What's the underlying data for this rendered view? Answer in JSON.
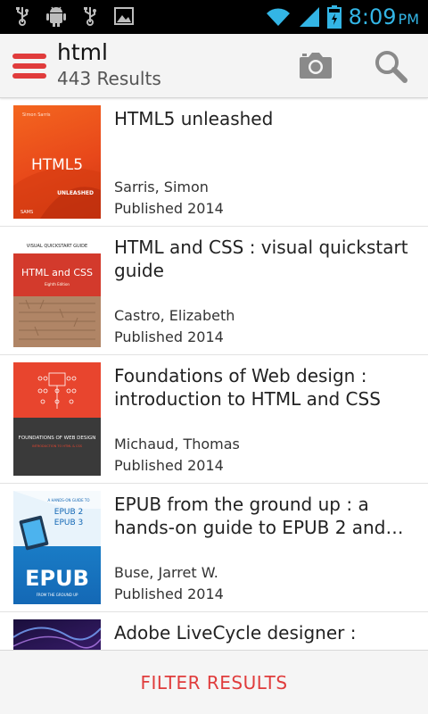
{
  "status_bar": {
    "time": "8:09",
    "ampm": "PM",
    "icons": [
      "usb-icon",
      "android-debug-icon",
      "usb-icon",
      "image-icon",
      "wifi-icon",
      "signal-icon",
      "battery-charging-icon"
    ]
  },
  "app_bar": {
    "title": "html",
    "subtitle": "443 Results",
    "menu_icon": "hamburger-menu-icon",
    "camera_icon": "camera-icon",
    "search_icon": "search-icon"
  },
  "results": [
    {
      "title": "HTML5 unleashed",
      "author": "Sarris, Simon",
      "published": "Published 2014",
      "cover": {
        "main": "HTML5",
        "sub": "UNLEASHED",
        "top": "Simon Sarris",
        "publisher": "SAMS"
      }
    },
    {
      "title": "HTML and CSS : visual quickstart guide",
      "author": "Castro, Elizabeth",
      "published": "Published 2014",
      "cover": {
        "top": "VISUAL QUICKSTART GUIDE",
        "main": "HTML and CSS",
        "sub": "Eighth Edition"
      }
    },
    {
      "title": "Foundations of Web design : introduction to HTML and CSS",
      "author": "Michaud, Thomas",
      "published": "Published 2014",
      "cover": {
        "main": "FOUNDATIONS OF WEB DESIGN",
        "sub": "INTRODUCTION TO HTML & CSS"
      }
    },
    {
      "title": "EPUB from the ground up : a hands-on guide to EPUB 2 and EPUB 3",
      "author": "Buse, Jarret W.",
      "published": "Published 2014",
      "cover": {
        "top": "A HANDS-ON GUIDE TO",
        "mid1": "EPUB 2",
        "mid2": "EPUB 3",
        "main": "EPUB",
        "sub": "FROM THE GROUND UP"
      }
    },
    {
      "title": "Adobe LiveCycle designer :",
      "author": "",
      "published": "",
      "cover": {}
    }
  ],
  "filter_bar": {
    "label": "FILTER RESULTS"
  },
  "colors": {
    "accent": "#e03c3c",
    "status_time": "#33b5e5",
    "appbar_bg": "#f4f4f4"
  }
}
